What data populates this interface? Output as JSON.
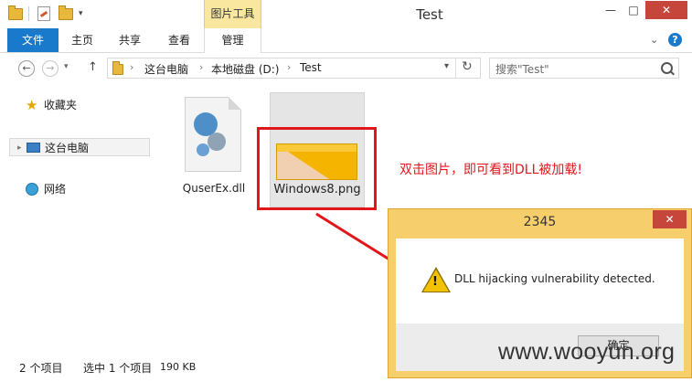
{
  "window": {
    "title": "Test",
    "contextual_tab_group": "图片工具",
    "minimize": "—",
    "maximize": "□",
    "close": "✕"
  },
  "ribbon": {
    "tabs": [
      "文件",
      "主页",
      "共享",
      "查看",
      "管理"
    ],
    "help": "?"
  },
  "address": {
    "crumbs": [
      "这台电脑",
      "本地磁盘 (D:)",
      "Test"
    ],
    "search_placeholder": "搜索\"Test\""
  },
  "navpane": {
    "items": [
      "收藏夹",
      "这台电脑",
      "网络"
    ]
  },
  "files": [
    {
      "name": "QuserEx.dll"
    },
    {
      "name": "Windows8.png"
    }
  ],
  "annotation": "双击图片，即可看到DLL被加载!",
  "status": {
    "count": "2 个项目",
    "selected": "选中 1 个项目",
    "size": "190 KB"
  },
  "dialog": {
    "title": "2345",
    "close": "✕",
    "message": "DLL hijacking vulnerability detected.",
    "ok": "确定"
  },
  "watermark": "www.wooyun.org",
  "colors": {
    "accent": "#1979ca",
    "annotation": "#e3161b",
    "dialog_frame": "#f7ce6c",
    "close_red": "#c7463b"
  }
}
